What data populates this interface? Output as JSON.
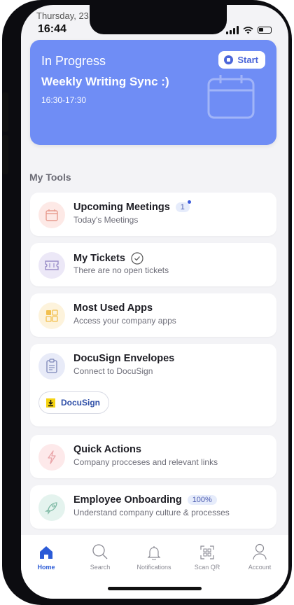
{
  "status_bar": {
    "prev_date": "Thursday, 23",
    "time": "16:44"
  },
  "progress_card": {
    "title": "In Progress",
    "meeting_name": "Weekly Writing Sync :)",
    "time_range": "16:30-17:30",
    "start_label": "Start",
    "color": "#6f8df5"
  },
  "section_title": "My Tools",
  "tools": [
    {
      "title": "Upcoming Meetings",
      "subtitle": "Today's Meetings",
      "badge": "1",
      "icon": "calendar-icon"
    },
    {
      "title": "My Tickets",
      "subtitle": "There are no open tickets",
      "icon": "ticket-icon"
    },
    {
      "title": "Most Used Apps",
      "subtitle": "Access your company apps",
      "icon": "apps-grid-icon"
    },
    {
      "title": "DocuSign Envelopes",
      "subtitle": "Connect to DocuSign",
      "button_label": "DocuSign",
      "icon": "clipboard-icon"
    },
    {
      "title": "Quick Actions",
      "subtitle": "Company procceses and relevant links",
      "icon": "lightning-icon"
    },
    {
      "title": "Employee Onboarding",
      "subtitle": "Understand company culture & processes",
      "badge": "100%",
      "icon": "rocket-icon"
    }
  ],
  "tabs": [
    {
      "label": "Home",
      "icon": "home-icon",
      "active": true
    },
    {
      "label": "Search",
      "icon": "search-icon"
    },
    {
      "label": "Notifications",
      "icon": "bell-icon"
    },
    {
      "label": "Scan QR",
      "icon": "qr-icon"
    },
    {
      "label": "Account",
      "icon": "user-icon"
    }
  ],
  "accent_color": "#2b5bd7"
}
